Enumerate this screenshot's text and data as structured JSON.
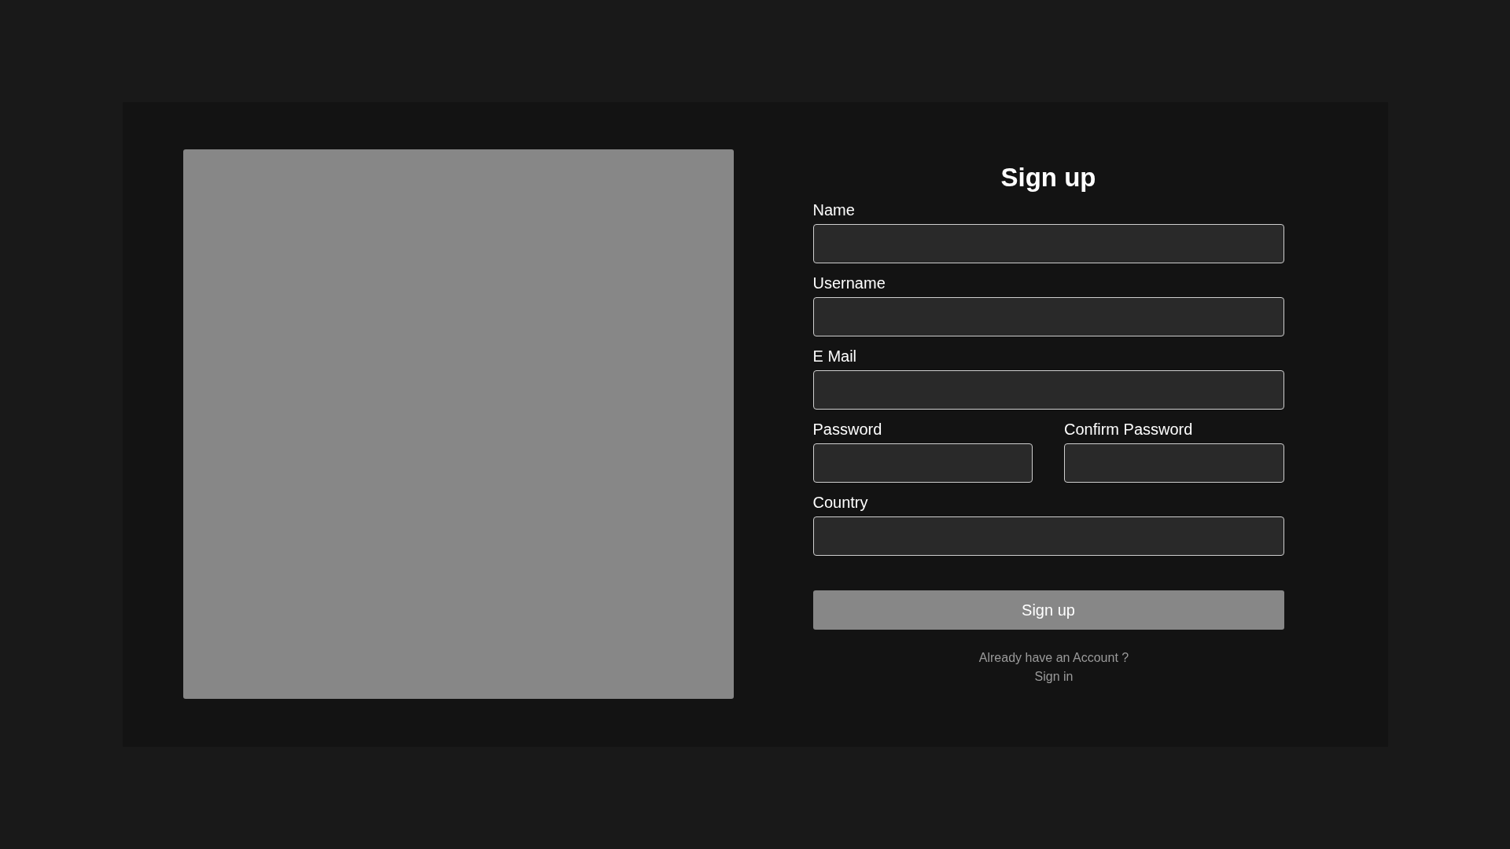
{
  "title": "Sign up",
  "rows": [
    {
      "fields": [
        {
          "label": "Name"
        }
      ]
    },
    {
      "fields": [
        {
          "label": "Username"
        }
      ]
    },
    {
      "fields": [
        {
          "label": "E Mail"
        }
      ]
    },
    {
      "fields": [
        {
          "label": "Password"
        },
        {
          "label": "Confirm Password"
        }
      ]
    },
    {
      "fields": [
        {
          "label": "Country"
        }
      ]
    }
  ],
  "submit": "Sign up",
  "prompt": "Already have an Account ?",
  "signin_link": "Sign in"
}
